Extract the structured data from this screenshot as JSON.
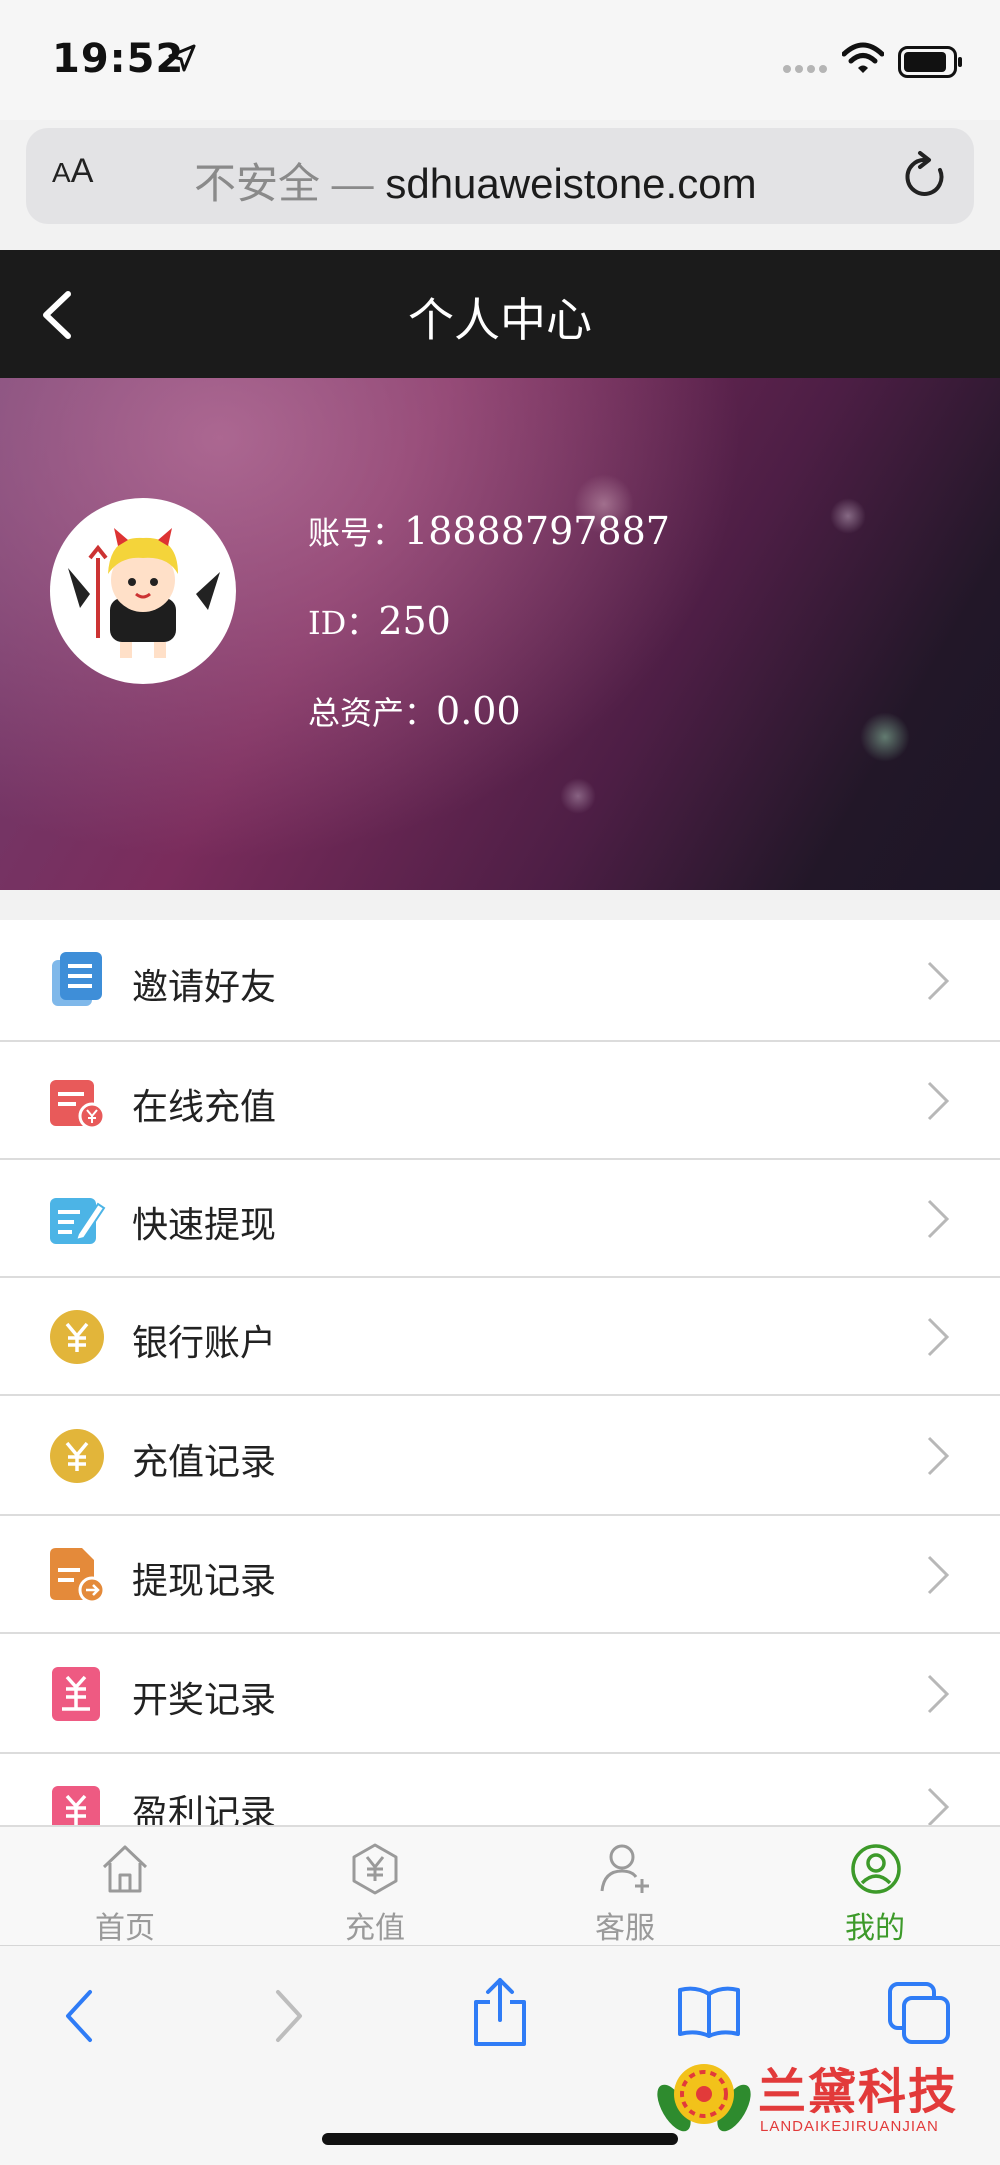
{
  "status_bar": {
    "time": "19:52"
  },
  "browser": {
    "aa_small": "A",
    "aa_large": "A",
    "insecure_label": "不安全 —",
    "host": "sdhuaweistone.com"
  },
  "header": {
    "title": "个人中心"
  },
  "profile": {
    "account_label": "账号：",
    "account_value": "18888797887",
    "id_label": "ID：",
    "id_value": "250",
    "assets_label": "总资产：",
    "assets_value": "0.00"
  },
  "menu": {
    "items": [
      {
        "label": "邀请好友",
        "icon": "invite-doc-icon"
      },
      {
        "label": "在线充值",
        "icon": "recharge-icon"
      },
      {
        "label": "快速提现",
        "icon": "withdraw-edit-icon"
      },
      {
        "label": "银行账户",
        "icon": "yuan-coin-icon"
      },
      {
        "label": "充值记录",
        "icon": "yuan-coin-icon"
      },
      {
        "label": "提现记录",
        "icon": "withdraw-record-icon"
      },
      {
        "label": "开奖记录",
        "icon": "lottery-record-icon"
      },
      {
        "label": "盈利记录",
        "icon": "profit-record-icon"
      }
    ]
  },
  "tabbar": {
    "tabs": [
      {
        "label": "首页",
        "icon": "home-icon"
      },
      {
        "label": "充值",
        "icon": "recharge-hex-icon"
      },
      {
        "label": "客服",
        "icon": "customer-service-icon"
      },
      {
        "label": "我的",
        "icon": "profile-icon",
        "active": true
      }
    ]
  },
  "watermark": {
    "text": "兰黛科技",
    "subtext": "LANDAIKEJIRUANJIAN"
  },
  "colors": {
    "accent_green": "#3d9a2a",
    "header_bg": "#1b1b1b",
    "ios_blue": "#2f7cf6"
  }
}
